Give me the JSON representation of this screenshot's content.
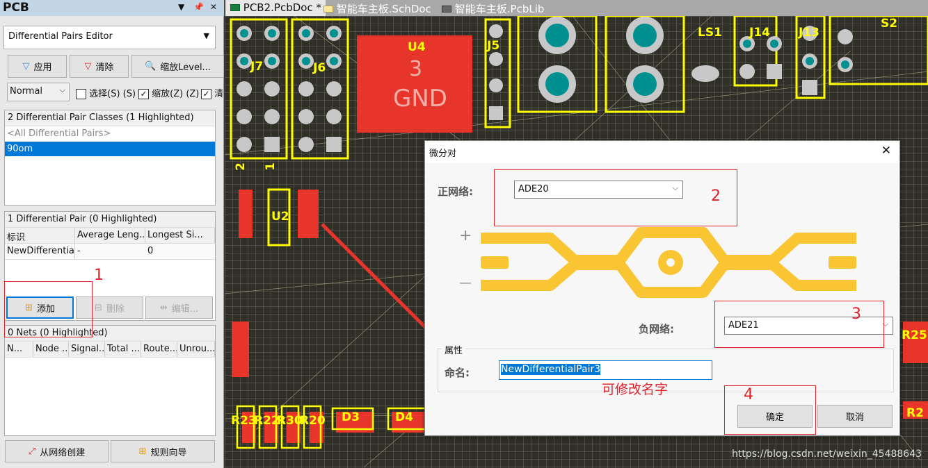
{
  "panel": {
    "title": "PCB",
    "mode_select": "Differential Pairs Editor",
    "buttons": {
      "apply": "应用",
      "clear": "清除",
      "zoom_level": "缩放Level..."
    },
    "filter_mode": "Normal",
    "checkboxes": [
      {
        "label": "选择(S) (S)",
        "checked": false
      },
      {
        "label": "缩放(Z) (Z)",
        "checked": true
      },
      {
        "label": "清",
        "checked": true
      }
    ],
    "classes": {
      "header": "2 Differential Pair Classes (1 Highlighted)",
      "items": [
        "<All Differential Pairs>",
        "90om"
      ],
      "selected": "90om"
    },
    "pairs": {
      "header": "1 Differential Pair (0 Highlighted)",
      "columns": [
        "标识",
        "Average Leng...",
        "Longest Si..."
      ],
      "rows": [
        [
          "NewDifferentialPair",
          "-",
          "0"
        ]
      ]
    },
    "pair_buttons": {
      "add": "添加",
      "delete": "删除",
      "edit": "编辑..."
    },
    "nets": {
      "header": "0 Nets (0 Highlighted)",
      "columns": [
        "N...",
        "Node ...",
        "Signal...",
        "Total ...",
        "Route...",
        "Unrou..."
      ]
    },
    "bottom_buttons": {
      "create_from_nets": "从网络创建",
      "rule_wizard": "规则向导"
    }
  },
  "tabs": [
    {
      "label": "PCB2.PcbDoc *",
      "icon": "pcb-doc-icon",
      "active": true
    },
    {
      "label": "智能车主板.SchDoc",
      "icon": "sch-doc-icon",
      "active": false
    },
    {
      "label": "智能车主板.PcbLib",
      "icon": "pcblib-icon",
      "active": false
    }
  ],
  "pcb": {
    "designators": [
      "J7",
      "J6",
      "U4",
      "3",
      "GND",
      "J5",
      "LS1",
      "J14",
      "J13",
      "S2",
      "U2",
      "D3",
      "D4",
      "R2",
      "R25",
      "R23",
      "R22",
      "R30",
      "R20",
      "2",
      "1",
      "3"
    ],
    "watermark": "https://blog.csdn.net/weixin_45488643"
  },
  "dialog": {
    "title": "微分对",
    "positive_label": "正网络:",
    "positive_net": "ADE20",
    "negative_label": "负网络:",
    "negative_net": "ADE21",
    "plus": "+",
    "minus": "—",
    "group_label": "属性",
    "name_label": "命名:",
    "name_value": "NewDifferentialPair3",
    "ok": "确定",
    "cancel": "取消"
  },
  "annotations": {
    "n1": "1",
    "n2": "2",
    "n3": "3",
    "n4": "4",
    "note": "可修改名字"
  },
  "colors": {
    "accent": "#0078d7",
    "annotation": "#e0222b",
    "silkscreen": "#ffff00",
    "trace": "#ffc933"
  }
}
